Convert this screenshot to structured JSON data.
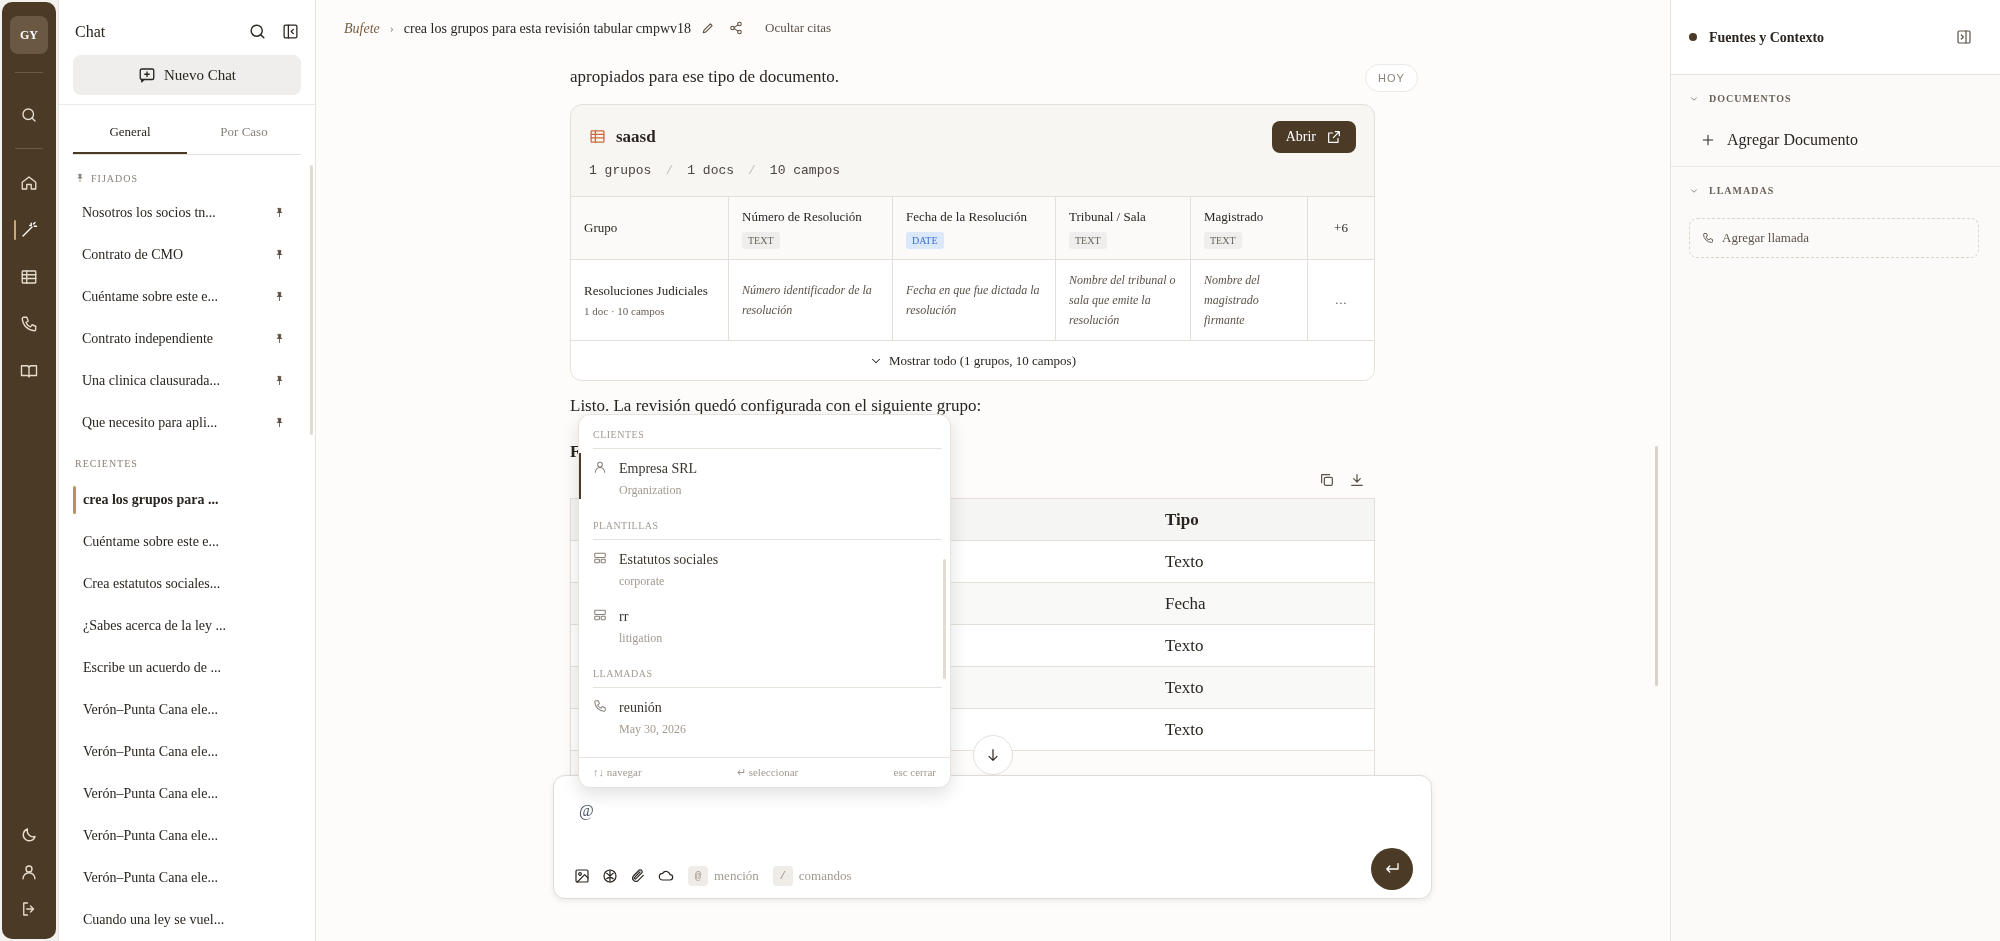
{
  "rail": {
    "avatar": "GY",
    "items": [
      {
        "kind": "search",
        "selected": false
      },
      {
        "kind": "home",
        "selected": false
      },
      {
        "kind": "wand",
        "selected": true
      },
      {
        "kind": "table",
        "selected": false
      },
      {
        "kind": "phone",
        "selected": false
      },
      {
        "kind": "book",
        "selected": false
      }
    ],
    "bottom": [
      {
        "kind": "moon"
      },
      {
        "kind": "user"
      },
      {
        "kind": "logout"
      }
    ]
  },
  "sidebar": {
    "title": "Chat",
    "new_chat": "Nuevo Chat",
    "tabs": [
      {
        "label": "General",
        "selected": true
      },
      {
        "label": "Por Caso",
        "selected": false
      }
    ],
    "pinned_heading": "FIJADOS",
    "pinned": [
      {
        "label": "Nosotros los socios tn..."
      },
      {
        "label": "Contrato de CMO"
      },
      {
        "label": "Cuéntame sobre este e..."
      },
      {
        "label": "Contrato independiente"
      },
      {
        "label": "Una clinica clausurada..."
      },
      {
        "label": "Que necesito para apli..."
      }
    ],
    "recent_heading": "RECIENTES",
    "recent": [
      {
        "label": "crea los grupos para ...",
        "selected": true
      },
      {
        "label": "Cuéntame sobre este e...",
        "selected": false
      },
      {
        "label": "Crea estatutos sociales...",
        "selected": false
      },
      {
        "label": "¿Sabes acerca de la ley ...",
        "selected": false
      },
      {
        "label": "Escribe un acuerdo de ...",
        "selected": false
      },
      {
        "label": "Verón–Punta Cana ele...",
        "selected": false
      },
      {
        "label": "Verón–Punta Cana ele...",
        "selected": false
      },
      {
        "label": "Verón–Punta Cana ele...",
        "selected": false
      },
      {
        "label": "Verón–Punta Cana ele...",
        "selected": false
      },
      {
        "label": "Verón–Punta Cana ele...",
        "selected": false
      },
      {
        "label": "Cuando una ley se vuel...",
        "selected": false
      }
    ]
  },
  "header": {
    "brand": "Bufete",
    "separator": "›",
    "title": "crea los grupos para esta revisión tabular cmpwv18",
    "hide_citations": "Ocultar citas"
  },
  "date_badge": "HOY",
  "intro": "apropiados para ese tipo de documento.",
  "card": {
    "title": "saasd",
    "open_button": "Abrir",
    "stats": [
      "1 grupos",
      "1 docs",
      "10 campos"
    ],
    "stat_separator": "/",
    "columns": [
      {
        "label": "Grupo"
      },
      {
        "label": "Número de Resolución",
        "type": "TEXT",
        "kind": "text"
      },
      {
        "label": "Fecha de la Resolución",
        "type": "DATE",
        "kind": "date"
      },
      {
        "label": "Tribunal / Sala",
        "type": "TEXT",
        "kind": "text"
      },
      {
        "label": "Magistrado",
        "type": "TEXT",
        "kind": "text"
      },
      {
        "label": "+6"
      }
    ],
    "row": {
      "group": "Resoluciones Judiciales",
      "group_meta": "1 doc · 10 campos",
      "cells": [
        "Número identificador de la resolución",
        "Fecha en que fue dictada la resolución",
        "Nombre del tribunal o sala que emite la resolución",
        "Nombre del magistrado firmante",
        "…"
      ]
    },
    "show_all": "Mostrar todo (1 grupos, 10 campos)"
  },
  "reply": "Listo. La revisión quedó configurada con el siguiente grupo:",
  "heading": "F",
  "fields_table": {
    "columns": [
      "Tipo"
    ],
    "rows": [
      "Texto",
      "Fecha",
      "Texto",
      "Texto",
      "Texto"
    ]
  },
  "mention_popup": {
    "sections": [
      {
        "heading": "CLIENTES",
        "items": [
          {
            "kind": "client",
            "title": "Empresa SRL",
            "subtitle": "Organization",
            "selected": true
          }
        ]
      },
      {
        "heading": "PLANTILLAS",
        "items": [
          {
            "kind": "template",
            "title": "Estatutos sociales",
            "subtitle": "corporate",
            "selected": false
          },
          {
            "kind": "template",
            "title": "rr",
            "subtitle": "litigation",
            "selected": false
          }
        ]
      },
      {
        "heading": "LLAMADAS",
        "items": [
          {
            "kind": "call",
            "title": "reunión",
            "subtitle": "May 30, 2026",
            "selected": false
          }
        ]
      }
    ],
    "hints": [
      "↑↓ navegar",
      "↵ seleccionar",
      "esc cerrar"
    ]
  },
  "composer": {
    "value": "@",
    "chips": [
      {
        "key": "@",
        "label": "mención"
      },
      {
        "key": "/",
        "label": "comandos"
      }
    ]
  },
  "right_panel": {
    "title": "Fuentes y Contexto",
    "sections": [
      {
        "heading": "DOCUMENTOS",
        "kind": "documents",
        "action": "Agregar Documento"
      },
      {
        "heading": "LLAMADAS",
        "kind": "calls",
        "action": "Agregar llamada"
      }
    ]
  }
}
